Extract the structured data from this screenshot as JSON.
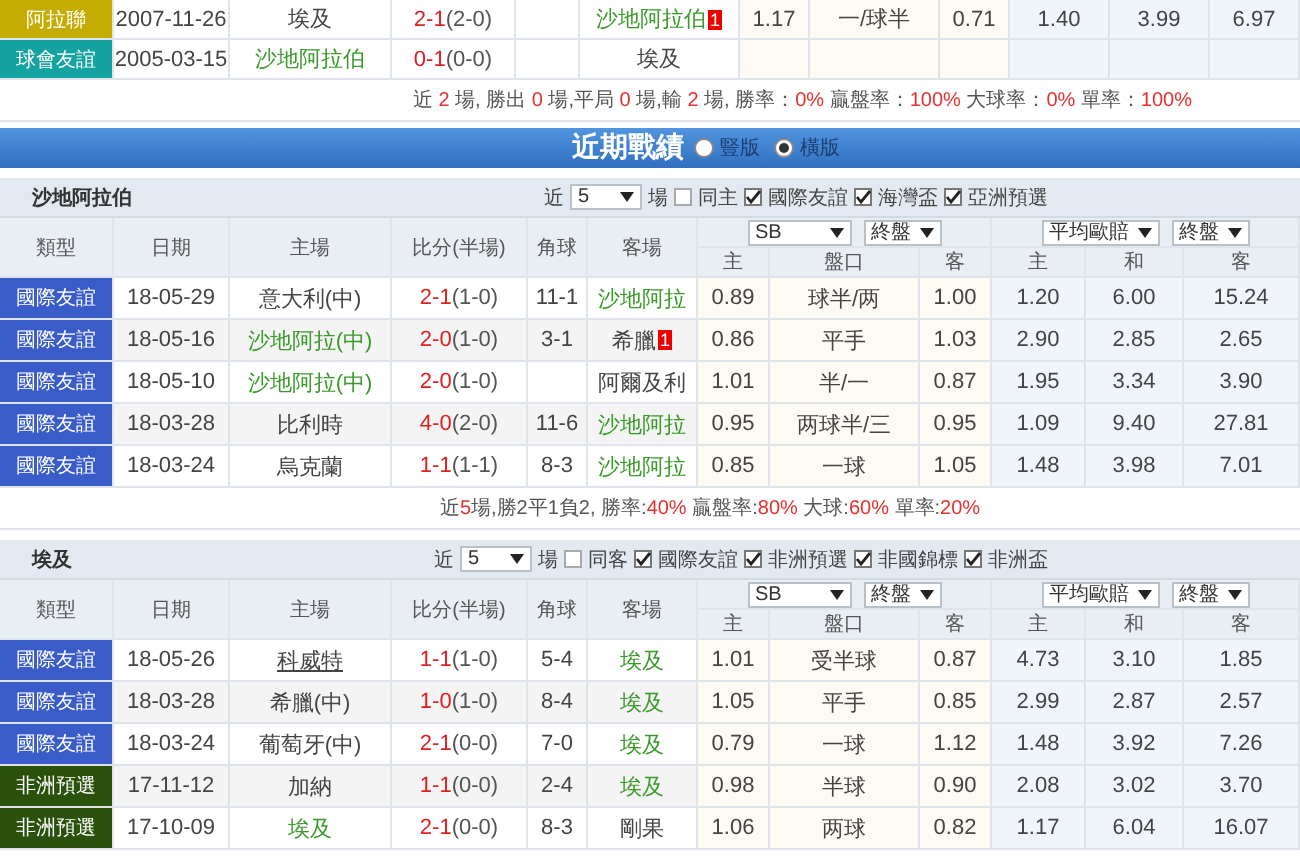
{
  "head_to_head": {
    "rows": [
      {
        "type": "阿拉聯",
        "color": "#c4ac00",
        "date": "2007-11-26",
        "home": {
          "name": "埃及",
          "kind": "plain"
        },
        "score": "2-1",
        "half": "(2-0)",
        "away": {
          "name": "沙地阿拉伯",
          "kind": "team",
          "red_card": "1"
        },
        "odds": [
          "1.17",
          "一/球半",
          "0.71",
          "1.40",
          "3.99",
          "6.97"
        ]
      },
      {
        "type": "球會友誼",
        "color": "#14a3a0",
        "date": "2005-03-15",
        "home": {
          "name": "沙地阿拉伯",
          "kind": "team"
        },
        "score": "0-1",
        "half": "(0-0)",
        "away": {
          "name": "埃及",
          "kind": "plain"
        }
      }
    ],
    "summary": [
      {
        "text": "近 ",
        "hot": false
      },
      {
        "text": "2",
        "hot": true
      },
      {
        "text": " 場, 勝出 ",
        "hot": false
      },
      {
        "text": "0",
        "hot": true
      },
      {
        "text": " 場,平局 ",
        "hot": false
      },
      {
        "text": "0",
        "hot": true
      },
      {
        "text": " 場,輸 ",
        "hot": false
      },
      {
        "text": "2",
        "hot": true
      },
      {
        "text": " 場, 勝率：",
        "hot": false
      },
      {
        "text": "0%",
        "hot": true
      },
      {
        "text": " 贏盤率：",
        "hot": false
      },
      {
        "text": "100%",
        "hot": true
      },
      {
        "text": " 大球率：",
        "hot": false
      },
      {
        "text": "0%",
        "hot": true
      },
      {
        "text": " 單率：",
        "hot": false
      },
      {
        "text": "100%",
        "hot": true
      }
    ]
  },
  "recent_records": {
    "title": "近期戰績",
    "layouts": [
      {
        "label": "豎版",
        "selected": false
      },
      {
        "label": "橫版",
        "selected": true
      }
    ],
    "teams": [
      {
        "name": "沙地阿拉伯",
        "filter": {
          "prefix": "近",
          "count": "5",
          "suffix": "場",
          "options": [
            {
              "label": "同主",
              "checked": false
            },
            {
              "label": "國際友誼",
              "checked": true
            },
            {
              "label": "海灣盃",
              "checked": true
            },
            {
              "label": "亞洲預選",
              "checked": true
            }
          ]
        },
        "columns": [
          "類型",
          "日期",
          "主場",
          "比分(半場)",
          "角球",
          "客場"
        ],
        "odds_selects": [
          "SB",
          "終盤",
          "平均歐賠",
          "終盤"
        ],
        "odds_columns": [
          "主",
          "盤口",
          "客",
          "主",
          "和",
          "客"
        ],
        "rows": [
          {
            "type": "國際友誼",
            "color": "#3a5cc8",
            "date": "18-05-29",
            "home": {
              "name": "意大利(中)",
              "kind": "plain"
            },
            "score": "2-1",
            "half": "(1-0)",
            "corner": "11-1",
            "away": {
              "name": "沙地阿拉",
              "kind": "team"
            },
            "odds": [
              "0.89",
              "球半/两",
              "1.00",
              "1.20",
              "6.00",
              "15.24"
            ]
          },
          {
            "type": "國際友誼",
            "color": "#3a5cc8",
            "date": "18-05-16",
            "home": {
              "name": "沙地阿拉(中)",
              "kind": "team"
            },
            "score": "2-0",
            "half": "(1-0)",
            "corner": "3-1",
            "away": {
              "name": "希臘",
              "kind": "plain",
              "red_card": "1"
            },
            "odds": [
              "0.86",
              "平手",
              "1.03",
              "2.90",
              "2.85",
              "2.65"
            ]
          },
          {
            "type": "國際友誼",
            "color": "#3a5cc8",
            "date": "18-05-10",
            "home": {
              "name": "沙地阿拉(中)",
              "kind": "team"
            },
            "score": "2-0",
            "half": "(1-0)",
            "away": {
              "name": "阿爾及利",
              "kind": "plain"
            },
            "odds": [
              "1.01",
              "半/一",
              "0.87",
              "1.95",
              "3.34",
              "3.90"
            ]
          },
          {
            "type": "國際友誼",
            "color": "#3a5cc8",
            "date": "18-03-28",
            "home": {
              "name": "比利時",
              "kind": "plain"
            },
            "score": "4-0",
            "half": "(2-0)",
            "corner": "11-6",
            "away": {
              "name": "沙地阿拉",
              "kind": "team"
            },
            "odds": [
              "0.95",
              "两球半/三",
              "0.95",
              "1.09",
              "9.40",
              "27.81"
            ]
          },
          {
            "type": "國際友誼",
            "color": "#3a5cc8",
            "date": "18-03-24",
            "home": {
              "name": "烏克蘭",
              "kind": "plain"
            },
            "score": "1-1",
            "half": "(1-1)",
            "corner": "8-3",
            "away": {
              "name": "沙地阿拉",
              "kind": "team"
            },
            "odds": [
              "0.85",
              "一球",
              "1.05",
              "1.48",
              "3.98",
              "7.01"
            ]
          }
        ],
        "summary": [
          {
            "text": "近",
            "hot": false
          },
          {
            "text": "5",
            "hot": true
          },
          {
            "text": "場,勝2平1負2, 勝率:",
            "hot": false
          },
          {
            "text": "40%",
            "hot": true
          },
          {
            "text": " 贏盤率:",
            "hot": false
          },
          {
            "text": "80%",
            "hot": true
          },
          {
            "text": " 大球:",
            "hot": false
          },
          {
            "text": "60%",
            "hot": true
          },
          {
            "text": " 單率:",
            "hot": false
          },
          {
            "text": "20%",
            "hot": true
          }
        ]
      },
      {
        "name": "埃及",
        "filter": {
          "prefix": "近",
          "count": "5",
          "suffix": "場",
          "options": [
            {
              "label": "同客",
              "checked": false
            },
            {
              "label": "國際友誼",
              "checked": true
            },
            {
              "label": "非洲預選",
              "checked": true
            },
            {
              "label": "非國錦標",
              "checked": true
            },
            {
              "label": "非洲盃",
              "checked": true
            }
          ]
        },
        "columns": [
          "類型",
          "日期",
          "主場",
          "比分(半場)",
          "角球",
          "客場"
        ],
        "odds_selects": [
          "SB",
          "終盤",
          "平均歐賠",
          "終盤"
        ],
        "odds_columns": [
          "主",
          "盤口",
          "客",
          "主",
          "和",
          "客"
        ],
        "rows": [
          {
            "type": "國際友誼",
            "color": "#3a5cc8",
            "date": "18-05-26",
            "home": {
              "name": "科威特",
              "kind": "link"
            },
            "score": "1-1",
            "half": "(1-0)",
            "corner": "5-4",
            "away": {
              "name": "埃及",
              "kind": "team"
            },
            "odds": [
              "1.01",
              "受半球",
              "0.87",
              "4.73",
              "3.10",
              "1.85"
            ]
          },
          {
            "type": "國際友誼",
            "color": "#3a5cc8",
            "date": "18-03-28",
            "home": {
              "name": "希臘(中)",
              "kind": "plain"
            },
            "score": "1-0",
            "half": "(1-0)",
            "corner": "8-4",
            "away": {
              "name": "埃及",
              "kind": "team"
            },
            "odds": [
              "1.05",
              "平手",
              "0.85",
              "2.99",
              "2.87",
              "2.57"
            ]
          },
          {
            "type": "國際友誼",
            "color": "#3a5cc8",
            "date": "18-03-24",
            "home": {
              "name": "葡萄牙(中)",
              "kind": "plain"
            },
            "score": "2-1",
            "half": "(0-0)",
            "corner": "7-0",
            "away": {
              "name": "埃及",
              "kind": "team"
            },
            "odds": [
              "0.79",
              "一球",
              "1.12",
              "1.48",
              "3.92",
              "7.26"
            ]
          },
          {
            "type": "非洲預選",
            "color": "#2b520c",
            "date": "17-11-12",
            "home": {
              "name": "加納",
              "kind": "plain"
            },
            "score": "1-1",
            "half": "(0-0)",
            "corner": "2-4",
            "away": {
              "name": "埃及",
              "kind": "team"
            },
            "odds": [
              "0.98",
              "半球",
              "0.90",
              "2.08",
              "3.02",
              "3.70"
            ]
          },
          {
            "type": "非洲預選",
            "color": "#2b520c",
            "date": "17-10-09",
            "home": {
              "name": "埃及",
              "kind": "team"
            },
            "score": "2-1",
            "half": "(0-0)",
            "corner": "8-3",
            "away": {
              "name": "剛果",
              "kind": "plain"
            },
            "odds": [
              "1.06",
              "两球",
              "0.82",
              "1.17",
              "6.04",
              "16.07"
            ]
          }
        ]
      }
    ]
  }
}
